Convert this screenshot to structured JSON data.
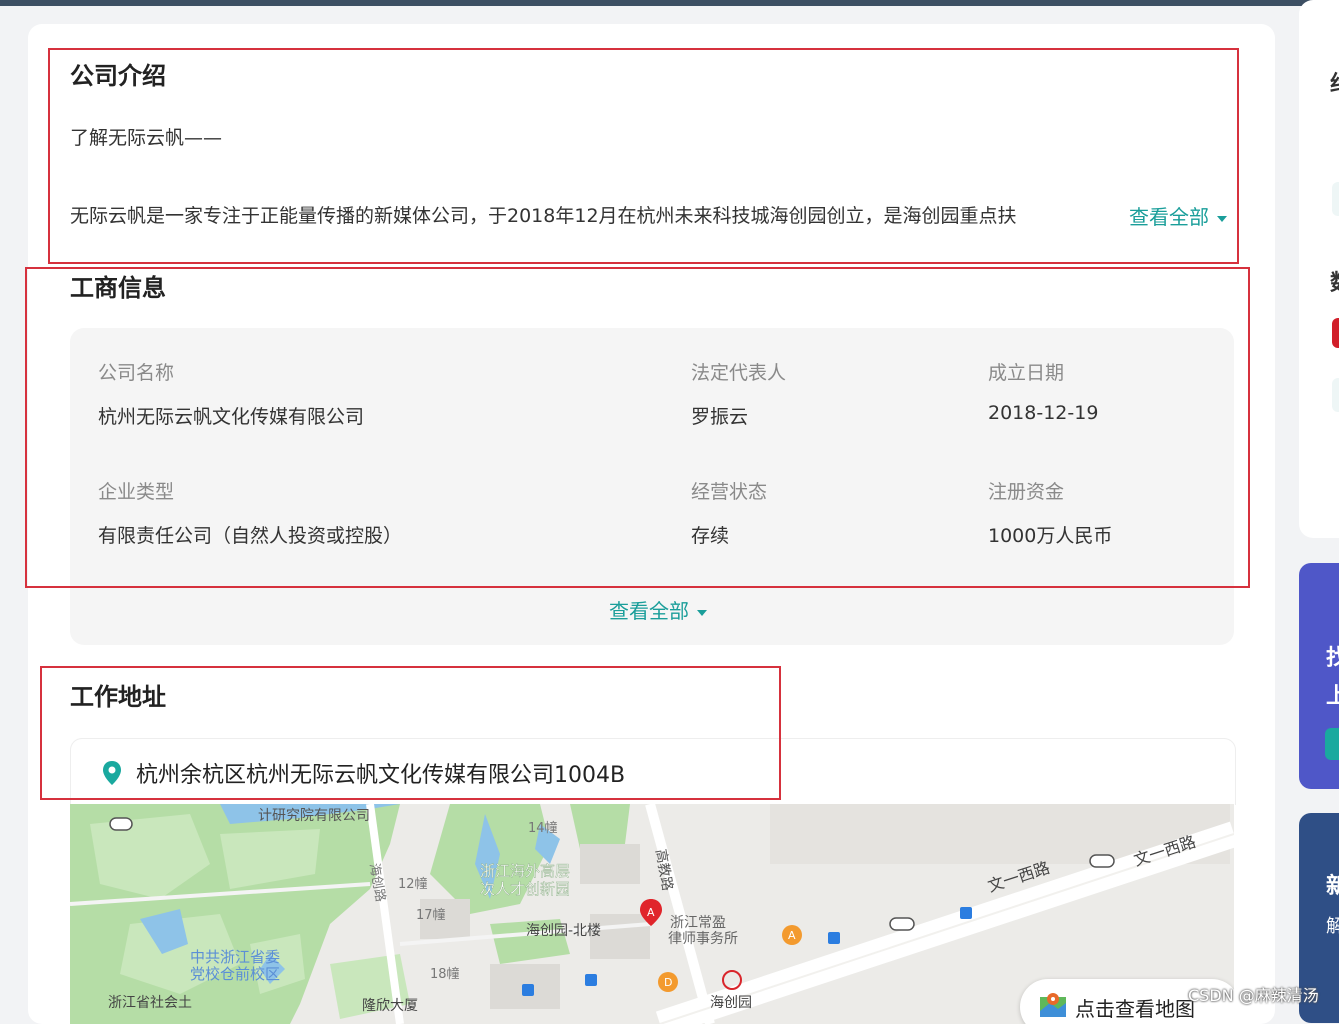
{
  "intro": {
    "title": "公司介绍",
    "subtitle": "了解无际云帆——",
    "text": "无际云帆是一家专注于正能量传播的新媒体公司，于2018年12月在杭州未来科技城海创园创立，是海创园重点扶",
    "more": "查看全部"
  },
  "business": {
    "title": "工商信息",
    "fields": [
      {
        "label": "公司名称",
        "value": "杭州无际云帆文化传媒有限公司"
      },
      {
        "label": "法定代表人",
        "value": "罗振云"
      },
      {
        "label": "成立日期",
        "value": "2018-12-19"
      },
      {
        "label": "企业类型",
        "value": "有限责任公司（自然人投资或控股）"
      },
      {
        "label": "经营状态",
        "value": "存续"
      },
      {
        "label": "注册资金",
        "value": "1000万人民币"
      }
    ],
    "more": "查看全部"
  },
  "address": {
    "title": "工作地址",
    "text": "杭州余杭区杭州无际云帆文化传媒有限公司1004B",
    "map_button": "点击查看地图",
    "map_labels": {
      "l1": "计研究院有限公司",
      "l2": "14幢",
      "l3": "海创路",
      "l4": "12幢",
      "l5": "浙江海外高层",
      "l6": "次人才创新园",
      "l7": "高教路",
      "l8": "17幢",
      "l9": "海创园-北楼",
      "l10": "浙江常盈",
      "l11": "律师事务所",
      "l12": "中共浙江省委",
      "l13": "党校仓前校区",
      "l14": "18幢",
      "l15": "浙江省社会土",
      "l16": "隆欣大厦",
      "l17": "海创园",
      "l18": "文一西路",
      "l19": "文一西路",
      "pin_a": "A",
      "poi_a": "A",
      "poi_d": "D"
    }
  },
  "right_panel": {
    "t1": "约",
    "t2": "数",
    "t3": "找",
    "t4": "上",
    "t5": "新",
    "t6": "解"
  },
  "watermark": "CSDN @麻辣清汤"
}
